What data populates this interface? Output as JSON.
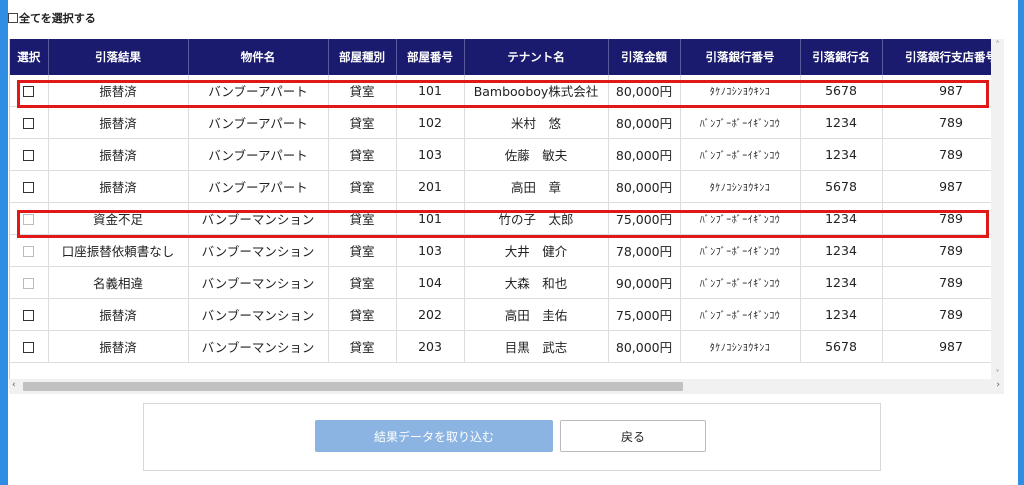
{
  "select_all_label": "全てを選択する",
  "columns": [
    "選択",
    "引落結果",
    "物件名",
    "部屋種別",
    "部屋番号",
    "テナント名",
    "引落金額",
    "引落銀行番号",
    "引落銀行名",
    "引落銀行支店番号"
  ],
  "rows": [
    {
      "checkbox_enabled": true,
      "result": "振替済",
      "property": "バンブーアパート",
      "room_type": "貸室",
      "room_no": "101",
      "tenant": "Bambooboy株式会社",
      "amount": "80,000円",
      "bank_kana": "ﾀｹﾉｺｼﾝﾖｳｷﾝｺ",
      "bank_no": "5678",
      "branch_no": "987"
    },
    {
      "checkbox_enabled": true,
      "result": "振替済",
      "property": "バンブーアパート",
      "room_type": "貸室",
      "room_no": "102",
      "tenant": "米村　悠",
      "amount": "80,000円",
      "bank_kana": "ﾊﾞﾝﾌﾞｰﾎﾞｰｲｷﾞﾝｺｳ",
      "bank_no": "1234",
      "branch_no": "789"
    },
    {
      "checkbox_enabled": true,
      "result": "振替済",
      "property": "バンブーアパート",
      "room_type": "貸室",
      "room_no": "103",
      "tenant": "佐藤　敏夫",
      "amount": "80,000円",
      "bank_kana": "ﾊﾞﾝﾌﾞｰﾎﾞｰｲｷﾞﾝｺｳ",
      "bank_no": "1234",
      "branch_no": "789"
    },
    {
      "checkbox_enabled": true,
      "result": "振替済",
      "property": "バンブーアパート",
      "room_type": "貸室",
      "room_no": "201",
      "tenant": "高田　章",
      "amount": "80,000円",
      "bank_kana": "ﾀｹﾉｺｼﾝﾖｳｷﾝｺ",
      "bank_no": "5678",
      "branch_no": "987"
    },
    {
      "checkbox_enabled": false,
      "result": "資金不足",
      "property": "バンブーマンション",
      "room_type": "貸室",
      "room_no": "101",
      "tenant": "竹の子　太郎",
      "amount": "75,000円",
      "bank_kana": "ﾊﾞﾝﾌﾞｰﾎﾞｰｲｷﾞﾝｺｳ",
      "bank_no": "1234",
      "branch_no": "789"
    },
    {
      "checkbox_enabled": false,
      "result": "口座振替依頼書なし",
      "property": "バンブーマンション",
      "room_type": "貸室",
      "room_no": "103",
      "tenant": "大井　健介",
      "amount": "78,000円",
      "bank_kana": "ﾊﾞﾝﾌﾞｰﾎﾞｰｲｷﾞﾝｺｳ",
      "bank_no": "1234",
      "branch_no": "789"
    },
    {
      "checkbox_enabled": false,
      "result": "名義相違",
      "property": "バンブーマンション",
      "room_type": "貸室",
      "room_no": "104",
      "tenant": "大森　和也",
      "amount": "90,000円",
      "bank_kana": "ﾊﾞﾝﾌﾞｰﾎﾞｰｲｷﾞﾝｺｳ",
      "bank_no": "1234",
      "branch_no": "789"
    },
    {
      "checkbox_enabled": true,
      "result": "振替済",
      "property": "バンブーマンション",
      "room_type": "貸室",
      "room_no": "202",
      "tenant": "高田　圭佑",
      "amount": "75,000円",
      "bank_kana": "ﾊﾞﾝﾌﾞｰﾎﾞｰｲｷﾞﾝｺｳ",
      "bank_no": "1234",
      "branch_no": "789"
    },
    {
      "checkbox_enabled": true,
      "result": "振替済",
      "property": "バンブーマンション",
      "room_type": "貸室",
      "room_no": "203",
      "tenant": "目黒　武志",
      "amount": "80,000円",
      "bank_kana": "ﾀｹﾉｺｼﾝﾖｳｷﾝｺ",
      "bank_no": "5678",
      "branch_no": "987"
    }
  ],
  "highlighted_rows": [
    0,
    4
  ],
  "buttons": {
    "import_label": "結果データを取り込む",
    "back_label": "戻る"
  },
  "colors": {
    "page_background": "#2f8de4",
    "header_background": "#1a1a6e",
    "highlight_border": "#e01818",
    "import_button": "#8cb4e2"
  },
  "scrollbar_icons": [
    "chevron-left-icon",
    "chevron-right-icon",
    "chevron-up-icon",
    "chevron-down-icon"
  ]
}
